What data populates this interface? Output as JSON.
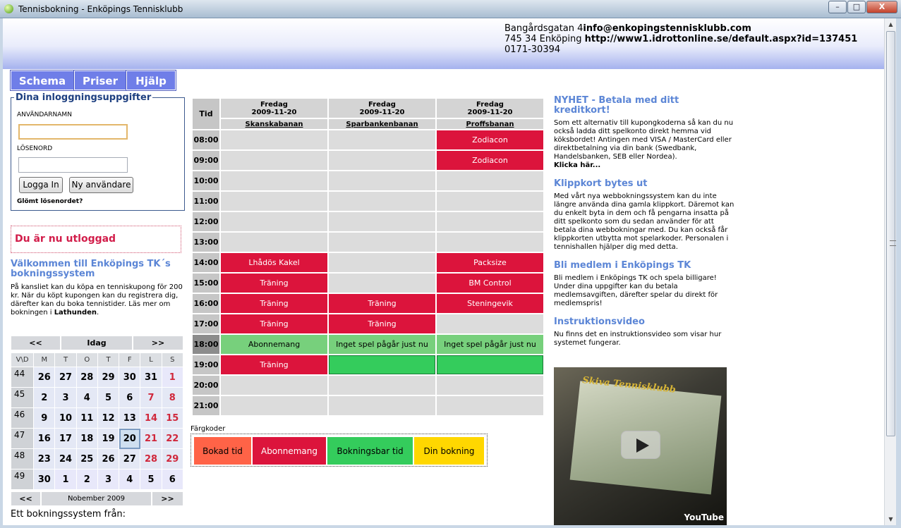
{
  "window": {
    "title": "Tennisbokning - Enköpings Tennisklubb",
    "min": "–",
    "max": "□",
    "close": "X"
  },
  "header": {
    "addr_line1": "Bangårdsgatan 4",
    "email": "info@enkopingstennisklubb.com",
    "addr_line2": "745 34 Enköping",
    "url": "http://www1.idrottonline.se/default.aspx?id=137451",
    "phone": "0171-30394"
  },
  "nav": [
    "Schema",
    "Priser",
    "Hjälp"
  ],
  "login": {
    "legend": "Dina inloggningsuppgifter",
    "username_label": "ANVÄNDARNAMN",
    "username_value": "",
    "password_label": "LÖSENORD",
    "password_value": "",
    "login_button": "Logga In",
    "new_user_button": "Ny användare",
    "forgot": "Glömt lösenordet?"
  },
  "logout_msg": "Du är nu utloggad",
  "welcome": {
    "title": "Välkommen till Enköpings TK´s bokningssystem",
    "text": "På kansliet kan du köpa en tenniskupong för 200 kr. När du köpt kupongen kan du registrera dig, därefter kan du boka tennistider. Läs mer om bokningen i ",
    "link": "Lathunden",
    "end": "."
  },
  "calendar": {
    "prev": "<<",
    "today": "Idag",
    "next": ">>",
    "headers": [
      "V\\D",
      "M",
      "T",
      "O",
      "T",
      "F",
      "L",
      "S"
    ],
    "weeks": [
      {
        "wk": "44",
        "days": [
          "26",
          "27",
          "28",
          "29",
          "30",
          "31",
          "1"
        ]
      },
      {
        "wk": "45",
        "days": [
          "2",
          "3",
          "4",
          "5",
          "6",
          "7",
          "8"
        ]
      },
      {
        "wk": "46",
        "days": [
          "9",
          "10",
          "11",
          "12",
          "13",
          "14",
          "15"
        ]
      },
      {
        "wk": "47",
        "days": [
          "16",
          "17",
          "18",
          "19",
          "20",
          "21",
          "22"
        ]
      },
      {
        "wk": "48",
        "days": [
          "23",
          "24",
          "25",
          "26",
          "27",
          "28",
          "29"
        ]
      },
      {
        "wk": "49",
        "days": [
          "30",
          "1",
          "2",
          "3",
          "4",
          "5",
          "6"
        ]
      }
    ],
    "month_prev": "<<",
    "month_label": "Nobember 2009",
    "month_next": ">>"
  },
  "footer_text": "Ett bokningssystem från:",
  "schedule": {
    "time_header": "Tid",
    "days": [
      "Fredag",
      "Fredag",
      "Fredag"
    ],
    "dates": [
      "2009-11-20",
      "2009-11-20",
      "2009-11-20"
    ],
    "courts": [
      "Skanskabanan",
      "Sparbankenbanan",
      "Proffsbanan"
    ],
    "rows": [
      {
        "time": "08:00",
        "cells": [
          {
            "t": "",
            "s": ""
          },
          {
            "t": "",
            "s": ""
          },
          {
            "t": "Zodiacon",
            "s": "red"
          }
        ]
      },
      {
        "time": "09:00",
        "cells": [
          {
            "t": "",
            "s": ""
          },
          {
            "t": "",
            "s": ""
          },
          {
            "t": "Zodiacon",
            "s": "red"
          }
        ]
      },
      {
        "time": "10:00",
        "cells": [
          {
            "t": "",
            "s": ""
          },
          {
            "t": "",
            "s": ""
          },
          {
            "t": "",
            "s": ""
          }
        ]
      },
      {
        "time": "11:00",
        "cells": [
          {
            "t": "",
            "s": ""
          },
          {
            "t": "",
            "s": ""
          },
          {
            "t": "",
            "s": ""
          }
        ]
      },
      {
        "time": "12:00",
        "cells": [
          {
            "t": "",
            "s": ""
          },
          {
            "t": "",
            "s": ""
          },
          {
            "t": "",
            "s": ""
          }
        ]
      },
      {
        "time": "13:00",
        "cells": [
          {
            "t": "",
            "s": ""
          },
          {
            "t": "",
            "s": ""
          },
          {
            "t": "",
            "s": ""
          }
        ]
      },
      {
        "time": "14:00",
        "cells": [
          {
            "t": "Lhådös Kakel",
            "s": "red"
          },
          {
            "t": "",
            "s": ""
          },
          {
            "t": "Packsize",
            "s": "red"
          }
        ]
      },
      {
        "time": "15:00",
        "cells": [
          {
            "t": "Träning",
            "s": "red"
          },
          {
            "t": "",
            "s": ""
          },
          {
            "t": "BM Control",
            "s": "red"
          }
        ]
      },
      {
        "time": "16:00",
        "cells": [
          {
            "t": "Träning",
            "s": "red"
          },
          {
            "t": "Träning",
            "s": "red"
          },
          {
            "t": "Steningevik",
            "s": "red"
          }
        ]
      },
      {
        "time": "17:00",
        "cells": [
          {
            "t": "Träning",
            "s": "red"
          },
          {
            "t": "Träning",
            "s": "red"
          },
          {
            "t": "",
            "s": ""
          }
        ]
      },
      {
        "time": "18:00",
        "now": true,
        "cells": [
          {
            "t": "Abonnemang",
            "s": "lgreen"
          },
          {
            "t": "Inget spel pågår just nu",
            "s": "lgreen"
          },
          {
            "t": "Inget spel pågår just nu",
            "s": "lgreen"
          }
        ]
      },
      {
        "time": "19:00",
        "cells": [
          {
            "t": "Träning",
            "s": "red"
          },
          {
            "t": "",
            "s": "green"
          },
          {
            "t": "",
            "s": "green"
          }
        ]
      },
      {
        "time": "20:00",
        "cells": [
          {
            "t": "",
            "s": ""
          },
          {
            "t": "",
            "s": ""
          },
          {
            "t": "",
            "s": ""
          }
        ]
      },
      {
        "time": "21:00",
        "cells": [
          {
            "t": "",
            "s": ""
          },
          {
            "t": "",
            "s": ""
          },
          {
            "t": "",
            "s": ""
          }
        ]
      }
    ]
  },
  "legend": {
    "title": "Färgkoder",
    "items": [
      {
        "label": "Bokad tid",
        "color": "#ff6347",
        "text": "#000"
      },
      {
        "label": "Abonnemang",
        "color": "#dc143c",
        "text": "#fff"
      },
      {
        "label": "Bokningsbar tid",
        "color": "#34cc5c",
        "text": "#000"
      },
      {
        "label": "Din bokning",
        "color": "#ffd700",
        "text": "#000"
      }
    ]
  },
  "news": [
    {
      "title": "NYHET - Betala med ditt kreditkort!",
      "text": "Som ett alternativ till kupongkoderna så kan du nu också ladda ditt spelkonto direkt hemma vid köksbordet! Antingen med VISA / MasterCard eller direktbetalning via din bank (Swedbank, Handelsbanken, SEB eller Nordea).",
      "link": "Klicka här..."
    },
    {
      "title": "Klippkort bytes ut",
      "text": "Med vårt nya webbokningssystem kan du inte längre använda dina gamla klippkort. Däremot kan du enkelt byta in dem och få pengarna insatta på ditt spelkonto som du sedan använder för att betala dina webbokningar med. Du kan också får klippkorten utbytta mot spelarkoder. Personalen i tennishallen hjälper dig med detta.",
      "link": ""
    },
    {
      "title": "Bli medlem i Enköpings TK",
      "text": "Bli medlem i Enköpings TK och spela billigare! Under dina uppgifter kan du betala medlemsavgiften, därefter spelar du direkt för medlemspris!",
      "link": ""
    },
    {
      "title": "Instruktionsvideo",
      "text": "Nu finns det en instruktionsvideo som visar hur systemet fungerar.",
      "link": ""
    }
  ],
  "video": {
    "title": "Skiva Tennisklubb",
    "brand": "YouTube"
  }
}
